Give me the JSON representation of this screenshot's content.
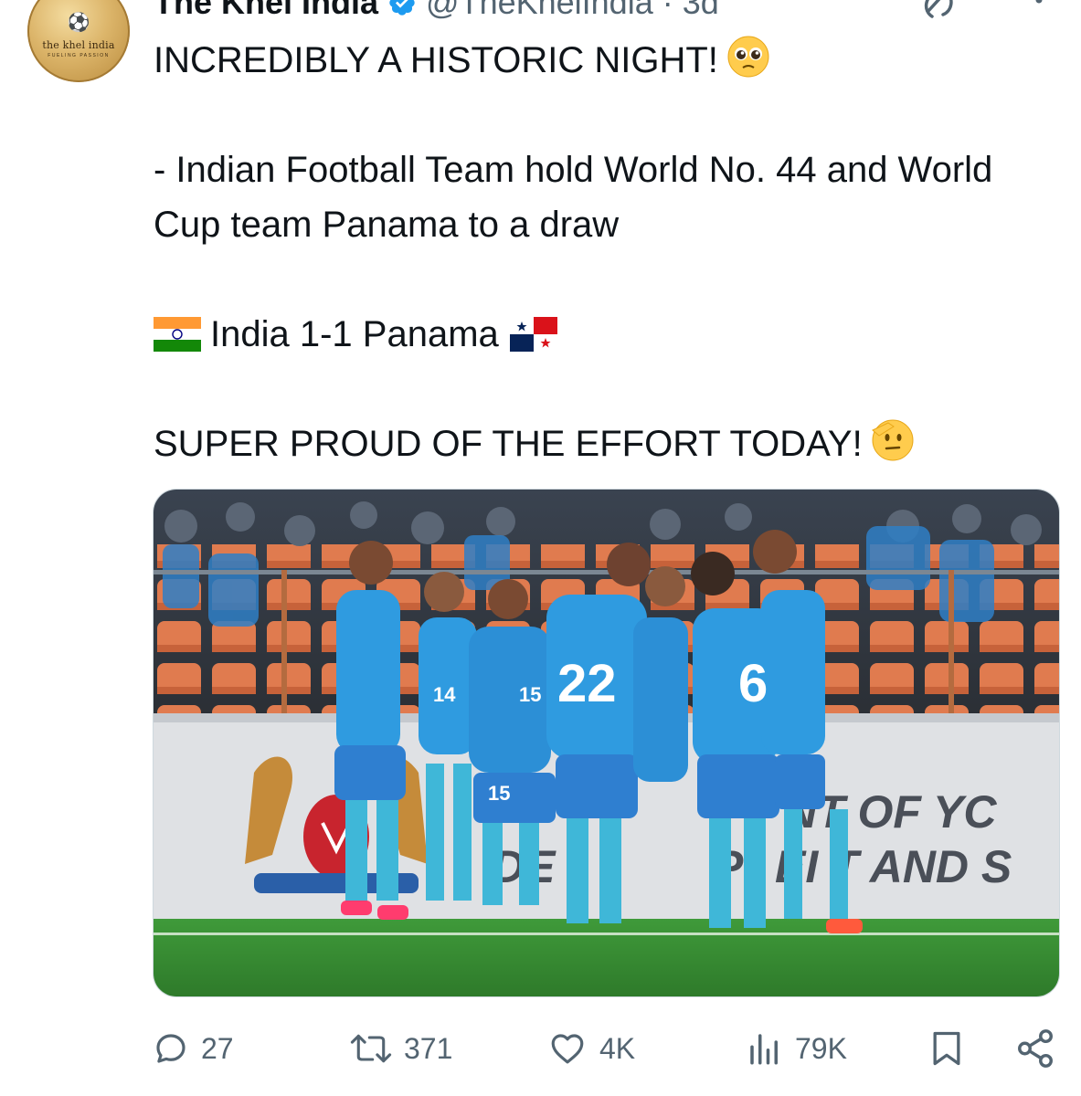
{
  "author": {
    "display_name": "The Khel India",
    "handle": "@TheKhelIndia",
    "time_ago": "· 3d",
    "avatar_brand": "the khel india",
    "avatar_tagline": "FUELING PASSION"
  },
  "tweet": {
    "line1": "INCREDIBLY A HISTORIC NIGHT!",
    "line2": "- Indian Football Team hold World No. 44 and World Cup team Panama to a draw",
    "score_line": "India 1-1 Panama",
    "line4": "SUPER PROUD OF THE EFFORT TODAY!"
  },
  "media": {
    "jerseys": [
      "22",
      "6",
      "14",
      "15",
      "15"
    ],
    "board_text_1": "NT OF YC",
    "board_text_2": "DE",
    "board_text_3": "P",
    "board_text_4": "EI T AND S"
  },
  "actions": {
    "replies": "27",
    "reposts": "371",
    "likes": "4K",
    "views": "79K"
  },
  "colors": {
    "text": "#0f1419",
    "secondary": "#536471",
    "verified": "#1d9bf0",
    "jersey": "#2f9be0",
    "seats": "#e07b4f"
  }
}
